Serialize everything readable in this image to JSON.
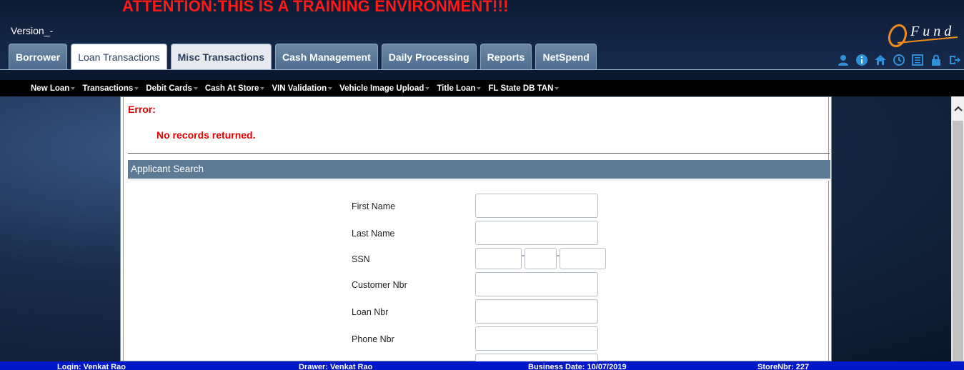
{
  "header": {
    "attention": "ATTENTION:THIS IS A TRAINING ENVIRONMENT!!!",
    "version": "Version_-",
    "logo_text": "Fund"
  },
  "tabs": [
    {
      "label": "Borrower"
    },
    {
      "label": "Loan Transactions"
    },
    {
      "label": "Misc Transactions"
    },
    {
      "label": "Cash Management"
    },
    {
      "label": "Daily Processing"
    },
    {
      "label": "Reports"
    },
    {
      "label": "NetSpend"
    }
  ],
  "top_icons": [
    "user-icon",
    "info-icon",
    "home-icon",
    "clock-icon",
    "list-icon",
    "lock-icon",
    "logout-icon"
  ],
  "menu": [
    {
      "label": "New Loan"
    },
    {
      "label": "Transactions"
    },
    {
      "label": "Debit Cards"
    },
    {
      "label": "Cash At Store"
    },
    {
      "label": "VIN Validation"
    },
    {
      "label": "Vehicle Image Upload"
    },
    {
      "label": "Title Loan"
    },
    {
      "label": "FL State DB TAN"
    }
  ],
  "error": {
    "label": "Error:",
    "message": "No records returned."
  },
  "search": {
    "title": "Applicant Search",
    "fields": {
      "first_name": "First Name",
      "last_name": "Last Name",
      "ssn": "SSN",
      "customer_nbr": "Customer Nbr",
      "loan_nbr": "Loan Nbr",
      "phone_nbr": "Phone Nbr"
    },
    "ssn_sep": "-"
  },
  "footer": {
    "login": "Login: Venkat Rao",
    "drawer": "Drawer: Venkat Rao",
    "business_date": "Business Date: 10/07/2019",
    "store": "StoreNbr: 227"
  },
  "colors": {
    "accent": "#5d7a95",
    "error": "#e00000",
    "attention": "#ff1a1a",
    "footer": "#0018c8",
    "logo": "#f08a1c"
  }
}
